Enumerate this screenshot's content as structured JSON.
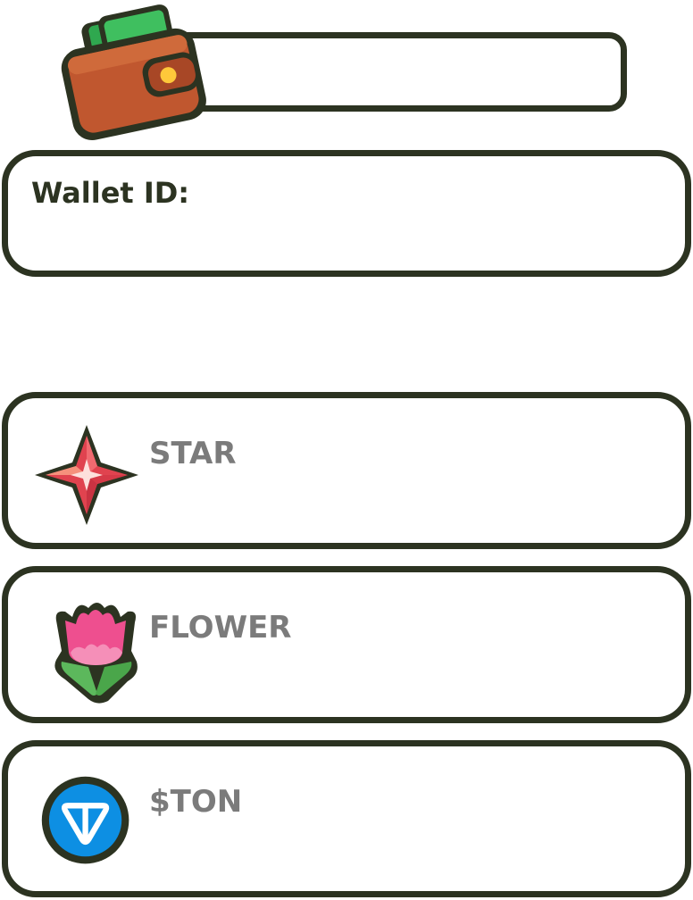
{
  "wallet": {
    "icon": "wallet-icon"
  },
  "wallet_id": {
    "label": "Wallet ID:"
  },
  "tokens": [
    {
      "name": "STAR",
      "icon": "star-icon"
    },
    {
      "name": "FLOWER",
      "icon": "flower-icon"
    },
    {
      "name": "$TON",
      "icon": "ton-icon"
    }
  ],
  "colors": {
    "outline": "#2c3321",
    "token_text": "#7b7b7b",
    "star_red": "#e0434f",
    "flower_pink": "#ee4f8f",
    "leaf_green": "#5cb85c",
    "ton_blue": "#0d8fe3",
    "wallet_brown": "#b5552f"
  }
}
